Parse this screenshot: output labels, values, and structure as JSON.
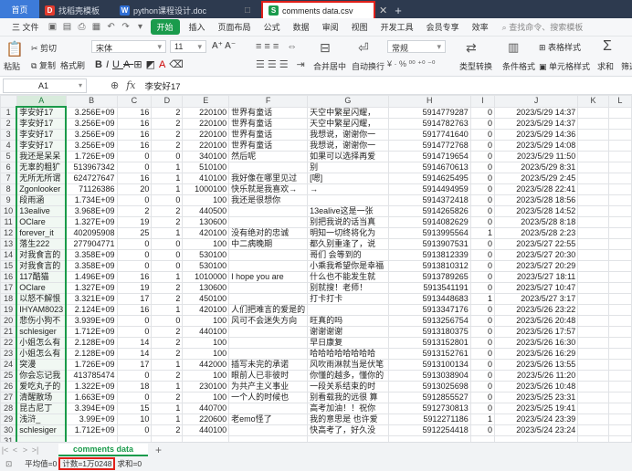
{
  "tabs": {
    "home": "首页",
    "tab1": "找稻壳模板",
    "tab2": "python课程设计.doc",
    "tab3": "comments data.csv"
  },
  "menu": {
    "file": "三 文件",
    "items": [
      "开始",
      "插入",
      "页面布局",
      "公式",
      "数据",
      "审阅",
      "视图",
      "开发工具",
      "会员专享",
      "效率"
    ],
    "search": "查找命令、搜索模板"
  },
  "toolbar": {
    "paste": "粘贴",
    "cut": "剪切",
    "copy": "复制",
    "format_painter": "格式刷",
    "font_name": "宋体",
    "font_size": "11",
    "merge": "合并居中",
    "wrap": "自动换行",
    "number_format": "常规",
    "type_convert": "类型转换",
    "conditional_format": "条件格式",
    "cell_style": "单元格样式",
    "table_style": "表格样式",
    "sum": "求和",
    "filter": "筛选"
  },
  "formula_bar": {
    "cell_ref": "A1",
    "fx": "fx",
    "value": "李安好17"
  },
  "columns": [
    "A",
    "B",
    "C",
    "D",
    "E",
    "F",
    "G",
    "H",
    "I",
    "J",
    "K",
    "L"
  ],
  "rows": [
    [
      "李安好17",
      "3.256E+09",
      "16",
      "2",
      "220100",
      "世界有童话",
      "天空中繁星闪耀，",
      "5914779287",
      "0",
      "2023/5/29 14:37"
    ],
    [
      "李安好17",
      "3.256E+09",
      "16",
      "2",
      "220100",
      "世界有童话",
      "天空中繁星闪耀，",
      "5914782763",
      "0",
      "2023/5/29 14:37"
    ],
    [
      "李安好17",
      "3.256E+09",
      "16",
      "2",
      "220100",
      "世界有童话",
      "我想说，谢谢你一",
      "5917741640",
      "0",
      "2023/5/29 14:36"
    ],
    [
      "李安好17",
      "3.256E+09",
      "16",
      "2",
      "220100",
      "世界有童话",
      "我想说，谢谢你一",
      "5914772768",
      "0",
      "2023/5/29 14:08"
    ],
    [
      "我还是呆呆",
      "1.726E+09",
      "0",
      "0",
      "340100",
      "然后呢",
      "如果可以选择再爱",
      "5914719654",
      "0",
      "2023/5/29 11:50"
    ],
    [
      "无辜的粗犷",
      "513967342",
      "0",
      "1",
      "510100",
      "",
      "别",
      "5914670613",
      "0",
      "2023/5/29 8:31"
    ],
    [
      "无所无所谓",
      "624727647",
      "16",
      "1",
      "410100",
      "我好像在哪里见过",
      "[嗯]",
      "5914625495",
      "0",
      "2023/5/29 2:45"
    ],
    [
      "Zgonlooker",
      "71126386",
      "20",
      "1",
      "1000100",
      "快乐就是我喜欢→",
      "→",
      "5914494959",
      "0",
      "2023/5/28 22:41"
    ],
    [
      "段雨涵",
      "1.734E+09",
      "0",
      "0",
      "100",
      "我还是很想你",
      "",
      "5914372418",
      "0",
      "2023/5/28 18:56"
    ],
    [
      "13ealive",
      "3.968E+09",
      "2",
      "2",
      "440500",
      "",
      "13ealive这是一张",
      "5914265826",
      "0",
      "2023/5/28 14:52"
    ],
    [
      "OClare",
      "1.327E+09",
      "19",
      "2",
      "130600",
      "",
      "别把我说的话当真",
      "5914082629",
      "0",
      "2023/5/28 8:18"
    ],
    [
      "forever_it",
      "402095908",
      "25",
      "1",
      "420100",
      "没有绝对的忠诚",
      "明知一切终将化为",
      "5913995564",
      "1",
      "2023/5/28 2:23"
    ],
    [
      "落生222",
      "277904771",
      "0",
      "0",
      "100",
      "中二病晚期",
      "都久别重逢了，说",
      "5913907531",
      "0",
      "2023/5/27 22:55"
    ],
    [
      "对我食言的",
      "3.358E+09",
      "0",
      "0",
      "530100",
      "",
      "哥们 会等到的",
      "5913812339",
      "0",
      "2023/5/27 20:30"
    ],
    [
      "对我食言的",
      "3.358E+09",
      "0",
      "0",
      "530100",
      "",
      "小乘我希望你是幸福",
      "5913810312",
      "0",
      "2023/5/27 20:29"
    ],
    [
      "117酷猫",
      "1.496E+09",
      "16",
      "1",
      "1010000",
      "I hope you are",
      "什么也不能发生就",
      "5913789265",
      "0",
      "2023/5/27 18:11"
    ],
    [
      "OClare",
      "1.327E+09",
      "19",
      "2",
      "130600",
      "",
      "别就搜！老师！",
      "5913541191",
      "0",
      "2023/5/27 10:47"
    ],
    [
      "以怒不解恨",
      "3.321E+09",
      "17",
      "2",
      "450100",
      "",
      "打卡打卡",
      "5913448683",
      "1",
      "2023/5/27 3:17"
    ],
    [
      "IHYAM8023",
      "2.124E+09",
      "16",
      "1",
      "420100",
      "人们把难言的爱是的",
      "",
      "5913347176",
      "0",
      "2023/5/26 23:22"
    ],
    [
      "悲伤小狗不",
      "3.939E+09",
      "0",
      "0",
      "100",
      "风可不会迷失方向",
      "旺真的吗",
      "5913256754",
      "0",
      "2023/5/26 20:48"
    ],
    [
      "schlesiger",
      "1.712E+09",
      "0",
      "2",
      "440100",
      "",
      "谢谢谢谢",
      "5913180375",
      "0",
      "2023/5/26 17:57"
    ],
    [
      "小姐怎么有",
      "2.128E+09",
      "14",
      "2",
      "100",
      "",
      "早日康复",
      "5913152801",
      "0",
      "2023/5/26 16:30"
    ],
    [
      "小姐怎么有",
      "2.128E+09",
      "14",
      "2",
      "100",
      "",
      "哈哈哈哈哈哈哈哈",
      "5913152761",
      "0",
      "2023/5/26 16:29"
    ],
    [
      "突漫",
      "1.726E+09",
      "17",
      "1",
      "442000",
      "插写未完的承诺",
      "风吹雨淋就当是伏笔",
      "5913100134",
      "0",
      "2023/5/26 13:55"
    ],
    [
      "你会忘记我",
      "413785474",
      "0",
      "2",
      "100",
      "眼前人已非彼时",
      "你懂的越多，懂你的",
      "5913038904",
      "0",
      "2023/5/26 11:20"
    ],
    [
      "爱吃丸子的",
      "1.322E+09",
      "18",
      "1",
      "230100",
      "为共产主义事业",
      "一段关系结束的时",
      "5913025698",
      "0",
      "2023/5/26 10:48"
    ],
    [
      "清醒散场",
      "1.663E+09",
      "0",
      "2",
      "100",
      "一个人的时候也",
      "别看载我的远很 算",
      "5912855527",
      "0",
      "2023/5/25 23:31"
    ],
    [
      "昆古尼丁",
      "3.394E+09",
      "15",
      "1",
      "440700",
      "",
      "高考加油！！祝你",
      "5912730813",
      "0",
      "2023/5/25 19:41"
    ],
    [
      "浅浒_",
      "3.99E+09",
      "10",
      "1",
      "220600",
      "老emo怪了",
      "我的意思是 也许爱",
      "5912271186",
      "1",
      "2023/5/24 23:39"
    ],
    [
      "schlesiger",
      "1.712E+09",
      "0",
      "2",
      "440100",
      "",
      "快高考了，好久没",
      "5912254418",
      "0",
      "2023/5/24 23:24"
    ]
  ],
  "row_numbers": [
    1,
    2,
    3,
    4,
    5,
    6,
    7,
    8,
    9,
    10,
    11,
    12,
    13,
    14,
    15,
    16,
    17,
    18,
    19,
    20,
    21,
    22,
    23,
    24,
    25,
    26,
    27,
    28,
    29,
    30,
    31
  ],
  "sheet": {
    "tab": "comments data"
  },
  "status": {
    "average": "平均值=0",
    "count": "计数=1万0248",
    "sum": "求和=0"
  }
}
